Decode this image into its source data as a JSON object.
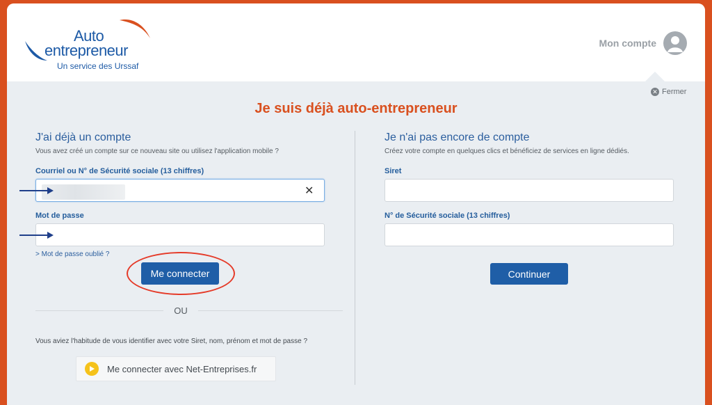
{
  "header": {
    "logo": {
      "line1": "Auto",
      "line2": "entrepreneur",
      "line3": "Un service des Urssaf"
    },
    "account_label": "Mon compte",
    "account_icon": "user-avatar-icon"
  },
  "close_label": "Fermer",
  "page_title": "Je suis déjà auto-entrepreneur",
  "login": {
    "heading": "J'ai déjà un compte",
    "subtext": "Vous avez créé un compte sur ce nouveau site ou utilisez l'application mobile ?",
    "email_label": "Courriel ou N° de Sécurité sociale (13 chiffres)",
    "email_value": "",
    "password_label": "Mot de passe",
    "password_value": "",
    "forgot_link": "> Mot de passe oublié ?",
    "submit_label": "Me connecter",
    "or_label": "OU",
    "legacy_hint": "Vous aviez l'habitude de vous identifier avec votre Siret, nom, prénom et mot de passe ?",
    "net_entreprises_label": "Me connecter avec Net-Entreprises.fr"
  },
  "signup": {
    "heading": "Je n'ai pas encore de compte",
    "subtext": "Créez votre compte en quelques clics et bénéficiez de services en ligne dédiés.",
    "siret_label": "Siret",
    "siret_value": "",
    "nss_label": "N° de Sécurité sociale (13 chiffres)",
    "nss_value": "",
    "continue_label": "Continuer"
  },
  "colors": {
    "brand_orange": "#d9501f",
    "brand_blue": "#1f5ea7",
    "annotation_red": "#e53a28"
  }
}
